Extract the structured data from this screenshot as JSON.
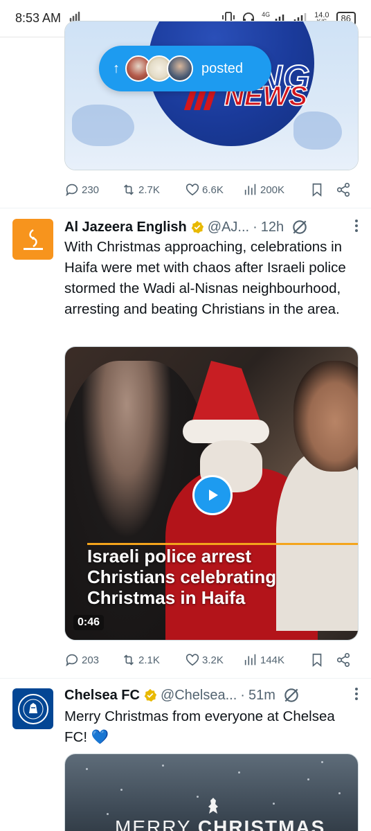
{
  "status_bar": {
    "time": "8:53 AM",
    "net_type": "4G",
    "net_speed": "14.0",
    "net_unit": "K/S",
    "battery": "86"
  },
  "posted_pill": {
    "label": "posted"
  },
  "tweet_1": {
    "image_text_breaking": "BREAKING",
    "image_text_news": "NEWS",
    "actions": {
      "replies": "230",
      "retweets": "2.7K",
      "likes": "6.6K",
      "views": "200K"
    }
  },
  "tweet_2": {
    "display_name": "Al Jazeera English",
    "handle": "@AJ...",
    "time": "12h",
    "text": "With Christmas approaching, celebrations in Haifa were met with chaos after Israeli police stormed the Wadi al-Nisnas neighbourhood, arresting and beating Christians in the area.",
    "video": {
      "caption_line_1": "Israeli police arrest",
      "caption_line_2": "Christians celebrating",
      "caption_line_3": "Christmas in Haifa",
      "duration": "0:46"
    },
    "actions": {
      "replies": "203",
      "retweets": "2.1K",
      "likes": "3.2K",
      "views": "144K"
    }
  },
  "tweet_3": {
    "display_name": "Chelsea FC",
    "handle": "@Chelsea...",
    "time": "51m",
    "text": "Merry Christmas from everyone at Chelsea FC! 💙",
    "image_text_merry": "MERRY ",
    "image_text_christmas": "CHRISTMAS"
  },
  "colors": {
    "accent": "#1d9bf0",
    "text_secondary": "#536471",
    "verified_gold": "#e8b900",
    "aje_orange": "#f7941d",
    "chelsea_blue": "#034694"
  }
}
